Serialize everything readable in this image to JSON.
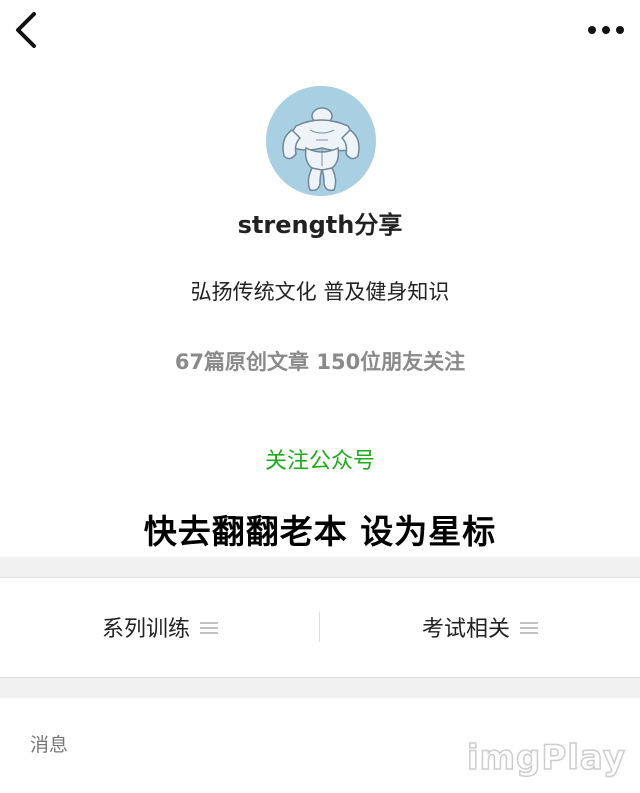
{
  "topbar": {
    "back_icon": "chevron-left-icon",
    "more_icon": "more-dots-icon"
  },
  "profile": {
    "avatar_icon": "bodybuilder-avatar",
    "name": "strength分享",
    "description": "弘扬传统文化 普及健身知识",
    "stats": "67篇原创文章  150位朋友关注",
    "follow_label": "关注公众号"
  },
  "banner": {
    "text": "快去翻翻老本 设为星标"
  },
  "menu": {
    "items": [
      {
        "label": "系列训练",
        "icon": "menu-lines-icon"
      },
      {
        "label": "考试相关",
        "icon": "menu-lines-icon"
      }
    ]
  },
  "section": {
    "messages_label": "消息"
  },
  "watermark": {
    "text": "imgPlay"
  },
  "colors": {
    "accent_green": "#1aad19",
    "muted_gray": "#8a8a8a",
    "band_bg": "#f1f1f1"
  }
}
